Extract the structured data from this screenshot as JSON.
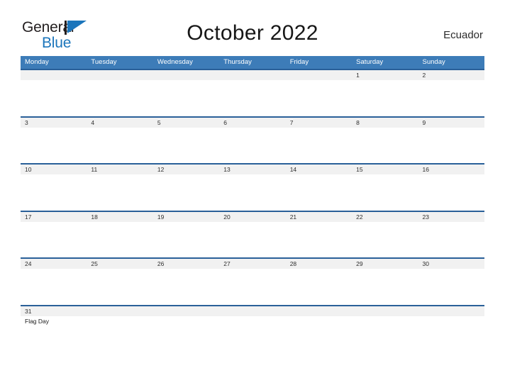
{
  "brand": {
    "name_part1": "General",
    "name_part2": "Blue",
    "mark": "flag-triangle-icon",
    "color_dark": "#231f20",
    "color_blue": "#1b75bb"
  },
  "header": {
    "title": "October 2022",
    "country": "Ecuador"
  },
  "theme": {
    "header_blue": "#3d7cb8",
    "rule_blue": "#2a6099",
    "strip_gray": "#f1f1f1",
    "page_background": "#ffffff",
    "text": "#2e2e2e"
  },
  "calendar": {
    "month": "October",
    "year": "2022",
    "day_headers": [
      "Monday",
      "Tuesday",
      "Wednesday",
      "Thursday",
      "Friday",
      "Saturday",
      "Sunday"
    ],
    "weeks": [
      {
        "days": [
          {
            "date": "",
            "events": []
          },
          {
            "date": "",
            "events": []
          },
          {
            "date": "",
            "events": []
          },
          {
            "date": "",
            "events": []
          },
          {
            "date": "",
            "events": []
          },
          {
            "date": "1",
            "events": []
          },
          {
            "date": "2",
            "events": []
          }
        ]
      },
      {
        "days": [
          {
            "date": "3",
            "events": []
          },
          {
            "date": "4",
            "events": []
          },
          {
            "date": "5",
            "events": []
          },
          {
            "date": "6",
            "events": []
          },
          {
            "date": "7",
            "events": []
          },
          {
            "date": "8",
            "events": []
          },
          {
            "date": "9",
            "events": []
          }
        ]
      },
      {
        "days": [
          {
            "date": "10",
            "events": []
          },
          {
            "date": "11",
            "events": []
          },
          {
            "date": "12",
            "events": []
          },
          {
            "date": "13",
            "events": []
          },
          {
            "date": "14",
            "events": []
          },
          {
            "date": "15",
            "events": []
          },
          {
            "date": "16",
            "events": []
          }
        ]
      },
      {
        "days": [
          {
            "date": "17",
            "events": []
          },
          {
            "date": "18",
            "events": []
          },
          {
            "date": "19",
            "events": []
          },
          {
            "date": "20",
            "events": []
          },
          {
            "date": "21",
            "events": []
          },
          {
            "date": "22",
            "events": []
          },
          {
            "date": "23",
            "events": []
          }
        ]
      },
      {
        "days": [
          {
            "date": "24",
            "events": []
          },
          {
            "date": "25",
            "events": []
          },
          {
            "date": "26",
            "events": []
          },
          {
            "date": "27",
            "events": []
          },
          {
            "date": "28",
            "events": []
          },
          {
            "date": "29",
            "events": []
          },
          {
            "date": "30",
            "events": []
          }
        ]
      },
      {
        "days": [
          {
            "date": "31",
            "events": [
              "Flag Day"
            ]
          },
          {
            "date": "",
            "events": []
          },
          {
            "date": "",
            "events": []
          },
          {
            "date": "",
            "events": []
          },
          {
            "date": "",
            "events": []
          },
          {
            "date": "",
            "events": []
          },
          {
            "date": "",
            "events": []
          }
        ]
      }
    ]
  }
}
